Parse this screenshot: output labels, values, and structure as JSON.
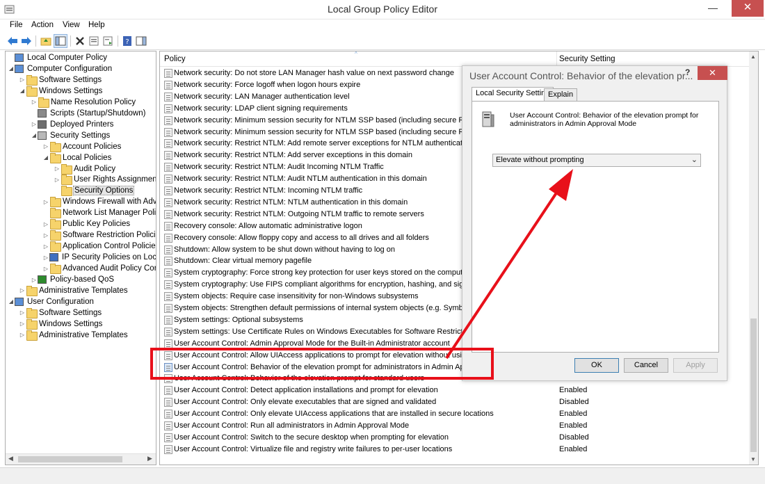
{
  "window": {
    "title": "Local Group Policy Editor",
    "min": "—",
    "max": "☐",
    "close": "✕"
  },
  "menu": [
    "File",
    "Action",
    "View",
    "Help"
  ],
  "tree": [
    {
      "label": "Local Computer Policy",
      "depth": 0,
      "exp": "",
      "icon": "computer-icon"
    },
    {
      "label": "Computer Configuration",
      "depth": 1,
      "exp": "◢",
      "icon": "computer-icon"
    },
    {
      "label": "Software Settings",
      "depth": 2,
      "exp": "▷",
      "icon": "folder-icon"
    },
    {
      "label": "Windows Settings",
      "depth": 2,
      "exp": "◢",
      "icon": "folder-icon"
    },
    {
      "label": "Name Resolution Policy",
      "depth": 3,
      "exp": "▷",
      "icon": "folder-icon"
    },
    {
      "label": "Scripts (Startup/Shutdown)",
      "depth": 3,
      "exp": "",
      "icon": "script-icon"
    },
    {
      "label": "Deployed Printers",
      "depth": 3,
      "exp": "▷",
      "icon": "printer-icon"
    },
    {
      "label": "Security Settings",
      "depth": 3,
      "exp": "◢",
      "icon": "security-icon"
    },
    {
      "label": "Account Policies",
      "depth": 4,
      "exp": "▷",
      "icon": "folder-icon"
    },
    {
      "label": "Local Policies",
      "depth": 4,
      "exp": "◢",
      "icon": "folder-icon"
    },
    {
      "label": "Audit Policy",
      "depth": 5,
      "exp": "▷",
      "icon": "folder-icon"
    },
    {
      "label": "User Rights Assignment",
      "depth": 5,
      "exp": "▷",
      "icon": "folder-icon"
    },
    {
      "label": "Security Options",
      "depth": 5,
      "exp": "",
      "icon": "folder-icon",
      "selected": true
    },
    {
      "label": "Windows Firewall with Adv",
      "depth": 4,
      "exp": "▷",
      "icon": "folder-icon"
    },
    {
      "label": "Network List Manager Polic",
      "depth": 4,
      "exp": "",
      "icon": "folder-icon"
    },
    {
      "label": "Public Key Policies",
      "depth": 4,
      "exp": "▷",
      "icon": "folder-icon"
    },
    {
      "label": "Software Restriction Policie",
      "depth": 4,
      "exp": "▷",
      "icon": "folder-icon"
    },
    {
      "label": "Application Control Policie",
      "depth": 4,
      "exp": "▷",
      "icon": "folder-icon"
    },
    {
      "label": "IP Security Policies on Loca",
      "depth": 4,
      "exp": "▷",
      "icon": "shield-icon"
    },
    {
      "label": "Advanced Audit Policy Cor",
      "depth": 4,
      "exp": "▷",
      "icon": "folder-icon"
    },
    {
      "label": "Policy-based QoS",
      "depth": 3,
      "exp": "▷",
      "icon": "chart-icon"
    },
    {
      "label": "Administrative Templates",
      "depth": 2,
      "exp": "▷",
      "icon": "folder-icon"
    },
    {
      "label": "User Configuration",
      "depth": 1,
      "exp": "◢",
      "icon": "user-icon"
    },
    {
      "label": "Software Settings",
      "depth": 2,
      "exp": "▷",
      "icon": "folder-icon"
    },
    {
      "label": "Windows Settings",
      "depth": 2,
      "exp": "▷",
      "icon": "folder-icon"
    },
    {
      "label": "Administrative Templates",
      "depth": 2,
      "exp": "▷",
      "icon": "folder-icon"
    }
  ],
  "list": {
    "col_policy": "Policy",
    "col_setting": "Security Setting",
    "rows": [
      {
        "policy": "Network security: Do not store LAN Manager hash value on next password change",
        "setting": ""
      },
      {
        "policy": "Network security: Force logoff when logon hours expire",
        "setting": ""
      },
      {
        "policy": "Network security: LAN Manager authentication level",
        "setting": ""
      },
      {
        "policy": "Network security: LDAP client signing requirements",
        "setting": ""
      },
      {
        "policy": "Network security: Minimum session security for NTLM SSP based (including secure RPC)",
        "setting": ""
      },
      {
        "policy": "Network security: Minimum session security for NTLM SSP based (including secure RPC)",
        "setting": ""
      },
      {
        "policy": "Network security: Restrict NTLM: Add remote server exceptions for NTLM authentication",
        "setting": ""
      },
      {
        "policy": "Network security: Restrict NTLM: Add server exceptions in this domain",
        "setting": ""
      },
      {
        "policy": "Network security: Restrict NTLM: Audit Incoming NTLM Traffic",
        "setting": ""
      },
      {
        "policy": "Network security: Restrict NTLM: Audit NTLM authentication in this domain",
        "setting": ""
      },
      {
        "policy": "Network security: Restrict NTLM: Incoming NTLM traffic",
        "setting": ""
      },
      {
        "policy": "Network security: Restrict NTLM: NTLM authentication in this domain",
        "setting": ""
      },
      {
        "policy": "Network security: Restrict NTLM: Outgoing NTLM traffic to remote servers",
        "setting": ""
      },
      {
        "policy": "Recovery console: Allow automatic administrative logon",
        "setting": ""
      },
      {
        "policy": "Recovery console: Allow floppy copy and access to all drives and all folders",
        "setting": ""
      },
      {
        "policy": "Shutdown: Allow system to be shut down without having to log on",
        "setting": ""
      },
      {
        "policy": "Shutdown: Clear virtual memory pagefile",
        "setting": ""
      },
      {
        "policy": "System cryptography: Force strong key protection for user keys stored on the computer",
        "setting": ""
      },
      {
        "policy": "System cryptography: Use FIPS compliant algorithms for encryption, hashing, and signing",
        "setting": ""
      },
      {
        "policy": "System objects: Require case insensitivity for non-Windows subsystems",
        "setting": ""
      },
      {
        "policy": "System objects: Strengthen default permissions of internal system objects (e.g. Symbolic",
        "setting": ""
      },
      {
        "policy": "System settings: Optional subsystems",
        "setting": ""
      },
      {
        "policy": "System settings: Use Certificate Rules on Windows Executables for Software Restriction Po",
        "setting": ""
      },
      {
        "policy": "User Account Control: Admin Approval Mode for the Built-in Administrator account",
        "setting": ""
      },
      {
        "policy": "User Account Control: Allow UIAccess applications to prompt for elevation without using",
        "setting": ""
      },
      {
        "policy": "User Account Control: Behavior of the elevation prompt for administrators in Admin App",
        "setting": "",
        "selected": true
      },
      {
        "policy": "User Account Control: Behavior of the elevation prompt for standard users",
        "setting": ""
      },
      {
        "policy": "User Account Control: Detect application installations and prompt for elevation",
        "setting": "Enabled"
      },
      {
        "policy": "User Account Control: Only elevate executables that are signed and validated",
        "setting": "Disabled"
      },
      {
        "policy": "User Account Control: Only elevate UIAccess applications that are installed in secure locations",
        "setting": "Enabled"
      },
      {
        "policy": "User Account Control: Run all administrators in Admin Approval Mode",
        "setting": "Enabled"
      },
      {
        "policy": "User Account Control: Switch to the secure desktop when prompting for elevation",
        "setting": "Disabled"
      },
      {
        "policy": "User Account Control: Virtualize file and registry write failures to per-user locations",
        "setting": "Enabled"
      }
    ]
  },
  "dialog": {
    "title": "User Account Control: Behavior of the elevation pr...",
    "help": "?",
    "close": "✕",
    "tabs": [
      "Local Security Setting",
      "Explain"
    ],
    "description": "User Account Control: Behavior of the elevation prompt for administrators in Admin Approval Mode",
    "selected_value": "Elevate without prompting",
    "ok": "OK",
    "cancel": "Cancel",
    "apply": "Apply"
  },
  "annotation": {
    "color": "#e8101a"
  }
}
